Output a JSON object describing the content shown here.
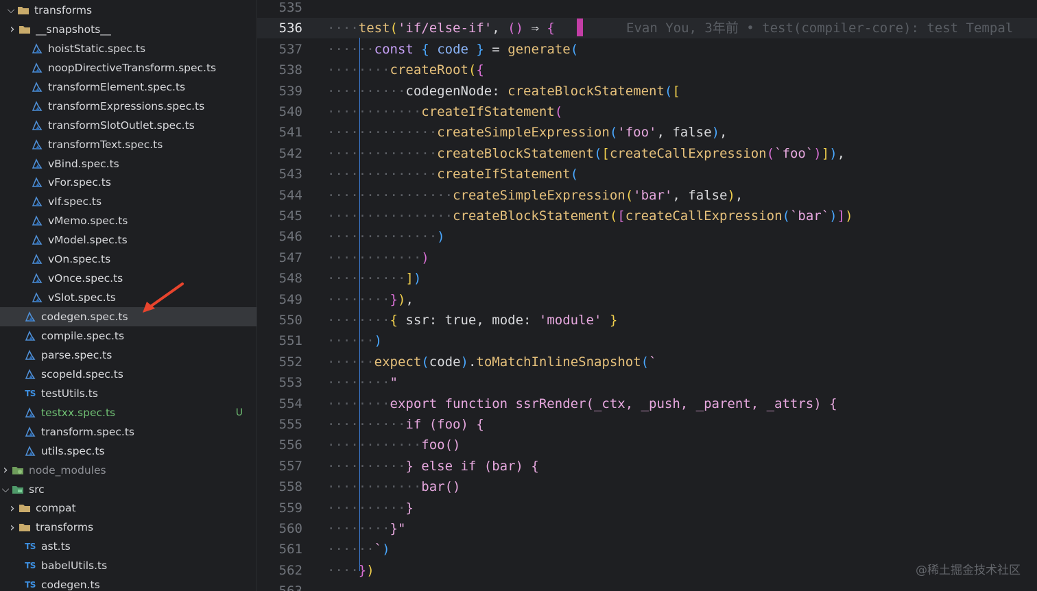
{
  "colors": {
    "background": "#1e1f22",
    "selected_row": "#36383c",
    "untracked": "#6fbf73",
    "ts_blue": "#3d8fe0",
    "arrow_red": "#e8442d"
  },
  "sidebar": {
    "items": [
      {
        "label": "transforms",
        "icon": "folder-open-icon",
        "chevron": "down"
      },
      {
        "label": "__snapshots__",
        "icon": "folder-icon",
        "chevron": "right"
      },
      {
        "label": "hoistStatic.spec.ts",
        "icon": "test-file-icon"
      },
      {
        "label": "noopDirectiveTransform.spec.ts",
        "icon": "test-file-icon"
      },
      {
        "label": "transformElement.spec.ts",
        "icon": "test-file-icon"
      },
      {
        "label": "transformExpressions.spec.ts",
        "icon": "test-file-icon"
      },
      {
        "label": "transformSlotOutlet.spec.ts",
        "icon": "test-file-icon"
      },
      {
        "label": "transformText.spec.ts",
        "icon": "test-file-icon"
      },
      {
        "label": "vBind.spec.ts",
        "icon": "test-file-icon"
      },
      {
        "label": "vFor.spec.ts",
        "icon": "test-file-icon"
      },
      {
        "label": "vIf.spec.ts",
        "icon": "test-file-icon"
      },
      {
        "label": "vMemo.spec.ts",
        "icon": "test-file-icon"
      },
      {
        "label": "vModel.spec.ts",
        "icon": "test-file-icon"
      },
      {
        "label": "vOn.spec.ts",
        "icon": "test-file-icon"
      },
      {
        "label": "vOnce.spec.ts",
        "icon": "test-file-icon"
      },
      {
        "label": "vSlot.spec.ts",
        "icon": "test-file-icon"
      },
      {
        "label": "codegen.spec.ts",
        "icon": "test-file-icon",
        "selected": true
      },
      {
        "label": "compile.spec.ts",
        "icon": "test-file-icon"
      },
      {
        "label": "parse.spec.ts",
        "icon": "test-file-icon"
      },
      {
        "label": "scopeId.spec.ts",
        "icon": "test-file-icon"
      },
      {
        "label": "testUtils.ts",
        "icon": "typescript-icon"
      },
      {
        "label": "testxx.spec.ts",
        "icon": "test-file-icon",
        "untracked": true,
        "badge": "U"
      },
      {
        "label": "transform.spec.ts",
        "icon": "test-file-icon"
      },
      {
        "label": "utils.spec.ts",
        "icon": "test-file-icon"
      },
      {
        "label": "node_modules",
        "icon": "node-modules-folder-icon",
        "chevron": "right",
        "dim": true
      },
      {
        "label": "src",
        "icon": "src-folder-icon",
        "chevron": "down"
      },
      {
        "label": "compat",
        "icon": "folder-icon",
        "chevron": "right"
      },
      {
        "label": "transforms",
        "icon": "folder-icon",
        "chevron": "right"
      },
      {
        "label": "ast.ts",
        "icon": "typescript-icon"
      },
      {
        "label": "babelUtils.ts",
        "icon": "typescript-icon"
      },
      {
        "label": "codegen.ts",
        "icon": "typescript-icon"
      }
    ],
    "ts_icon_text": "TS"
  },
  "editor": {
    "current_line": "536",
    "blame": "Evan You, 3年前 • test(compiler-core): test Tempal",
    "lines": [
      {
        "n": "535",
        "ws": "",
        "segs": []
      },
      {
        "n": "536",
        "ws": "····",
        "segs": [
          [
            "fn",
            "test"
          ],
          [
            "br1",
            "("
          ],
          [
            "str",
            "'if/else-if'"
          ],
          [
            "pl",
            ", "
          ],
          [
            "br2",
            "()"
          ],
          [
            "pl",
            " ⇒ "
          ],
          [
            "br2",
            "{"
          ]
        ]
      },
      {
        "n": "537",
        "ws": "····",
        "segs": [
          [
            "ws",
            "··"
          ],
          [
            "kw",
            "const"
          ],
          [
            "pl",
            " "
          ],
          [
            "br3",
            "{"
          ],
          [
            "var",
            " code "
          ],
          [
            "br3",
            "}"
          ],
          [
            "pl",
            " = "
          ],
          [
            "fn",
            "generate"
          ],
          [
            "br3",
            "("
          ]
        ]
      },
      {
        "n": "538",
        "ws": "····",
        "segs": [
          [
            "ws",
            "····"
          ],
          [
            "fn",
            "createRoot"
          ],
          [
            "br1",
            "("
          ],
          [
            "br2",
            "{"
          ]
        ]
      },
      {
        "n": "539",
        "ws": "····",
        "segs": [
          [
            "ws",
            "······"
          ],
          [
            "pl",
            "codegenNode: "
          ],
          [
            "fn",
            "createBlockStatement"
          ],
          [
            "br3",
            "("
          ],
          [
            "br1",
            "["
          ]
        ]
      },
      {
        "n": "540",
        "ws": "····",
        "segs": [
          [
            "ws",
            "········"
          ],
          [
            "fn",
            "createIfStatement"
          ],
          [
            "br2",
            "("
          ]
        ]
      },
      {
        "n": "541",
        "ws": "····",
        "segs": [
          [
            "ws",
            "··········"
          ],
          [
            "fn",
            "createSimpleExpression"
          ],
          [
            "br3",
            "("
          ],
          [
            "str",
            "'foo'"
          ],
          [
            "pl",
            ", false"
          ],
          [
            "br3",
            ")"
          ],
          [
            "pl",
            ","
          ]
        ]
      },
      {
        "n": "542",
        "ws": "····",
        "segs": [
          [
            "ws",
            "··········"
          ],
          [
            "fn",
            "createBlockStatement"
          ],
          [
            "br3",
            "("
          ],
          [
            "br1",
            "["
          ],
          [
            "fn",
            "createCallExpression"
          ],
          [
            "br2",
            "("
          ],
          [
            "str",
            "`foo`"
          ],
          [
            "br2",
            ")"
          ],
          [
            "br1",
            "]"
          ],
          [
            "br3",
            ")"
          ],
          [
            "pl",
            ","
          ]
        ]
      },
      {
        "n": "543",
        "ws": "····",
        "segs": [
          [
            "ws",
            "··········"
          ],
          [
            "fn",
            "createIfStatement"
          ],
          [
            "br3",
            "("
          ]
        ]
      },
      {
        "n": "544",
        "ws": "····",
        "segs": [
          [
            "ws",
            "············"
          ],
          [
            "fn",
            "createSimpleExpression"
          ],
          [
            "br1",
            "("
          ],
          [
            "str",
            "'bar'"
          ],
          [
            "pl",
            ", false"
          ],
          [
            "br1",
            ")"
          ],
          [
            "pl",
            ","
          ]
        ]
      },
      {
        "n": "545",
        "ws": "····",
        "segs": [
          [
            "ws",
            "············"
          ],
          [
            "fn",
            "createBlockStatement"
          ],
          [
            "br1",
            "("
          ],
          [
            "br2",
            "["
          ],
          [
            "fn",
            "createCallExpression"
          ],
          [
            "br3",
            "("
          ],
          [
            "str",
            "`bar`"
          ],
          [
            "br3",
            ")"
          ],
          [
            "br2",
            "]"
          ],
          [
            "br1",
            ")"
          ]
        ]
      },
      {
        "n": "546",
        "ws": "····",
        "segs": [
          [
            "ws",
            "··········"
          ],
          [
            "br3",
            ")"
          ]
        ]
      },
      {
        "n": "547",
        "ws": "····",
        "segs": [
          [
            "ws",
            "········"
          ],
          [
            "br2",
            ")"
          ]
        ]
      },
      {
        "n": "548",
        "ws": "····",
        "segs": [
          [
            "ws",
            "······"
          ],
          [
            "br1",
            "]"
          ],
          [
            "br3",
            ")"
          ]
        ]
      },
      {
        "n": "549",
        "ws": "····",
        "segs": [
          [
            "ws",
            "····"
          ],
          [
            "br2",
            "}"
          ],
          [
            "br1",
            ")"
          ],
          [
            "pl",
            ","
          ]
        ]
      },
      {
        "n": "550",
        "ws": "····",
        "segs": [
          [
            "ws",
            "····"
          ],
          [
            "br1",
            "{"
          ],
          [
            "pl",
            " ssr: true, mode: "
          ],
          [
            "str",
            "'module'"
          ],
          [
            "pl",
            " "
          ],
          [
            "br1",
            "}"
          ]
        ]
      },
      {
        "n": "551",
        "ws": "····",
        "segs": [
          [
            "ws",
            "··"
          ],
          [
            "br3",
            ")"
          ]
        ]
      },
      {
        "n": "552",
        "ws": "····",
        "segs": [
          [
            "ws",
            "··"
          ],
          [
            "fn",
            "expect"
          ],
          [
            "br3",
            "("
          ],
          [
            "pl",
            "code"
          ],
          [
            "br3",
            ")"
          ],
          [
            "pl",
            "."
          ],
          [
            "fn",
            "toMatchInlineSnapshot"
          ],
          [
            "br3",
            "("
          ],
          [
            "str",
            "`"
          ]
        ]
      },
      {
        "n": "553",
        "ws": "····",
        "segs": [
          [
            "ws",
            "····"
          ],
          [
            "str",
            "\""
          ]
        ]
      },
      {
        "n": "554",
        "ws": "····",
        "segs": [
          [
            "ws",
            "····"
          ],
          [
            "str",
            "export function ssrRender(_ctx, _push, _parent, _attrs) {"
          ]
        ]
      },
      {
        "n": "555",
        "ws": "····",
        "segs": [
          [
            "ws",
            "······"
          ],
          [
            "str",
            "if (foo) {"
          ]
        ]
      },
      {
        "n": "556",
        "ws": "····",
        "segs": [
          [
            "ws",
            "········"
          ],
          [
            "str",
            "foo()"
          ]
        ]
      },
      {
        "n": "557",
        "ws": "····",
        "segs": [
          [
            "ws",
            "······"
          ],
          [
            "str",
            "} else if (bar) {"
          ]
        ]
      },
      {
        "n": "558",
        "ws": "····",
        "segs": [
          [
            "ws",
            "········"
          ],
          [
            "str",
            "bar()"
          ]
        ]
      },
      {
        "n": "559",
        "ws": "····",
        "segs": [
          [
            "ws",
            "······"
          ],
          [
            "str",
            "}"
          ]
        ]
      },
      {
        "n": "560",
        "ws": "····",
        "segs": [
          [
            "ws",
            "····"
          ],
          [
            "str",
            "}\""
          ]
        ]
      },
      {
        "n": "561",
        "ws": "····",
        "segs": [
          [
            "ws",
            "··"
          ],
          [
            "str",
            "`"
          ],
          [
            "br3",
            ")"
          ]
        ]
      },
      {
        "n": "562",
        "ws": "····",
        "segs": [
          [
            "br2",
            "}"
          ],
          [
            "br1",
            ")"
          ]
        ]
      },
      {
        "n": "563",
        "ws": "",
        "segs": []
      }
    ]
  },
  "watermark": "@稀土掘金技术社区"
}
